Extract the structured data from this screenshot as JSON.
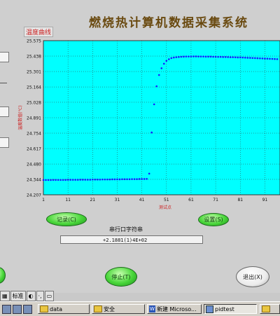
{
  "window": {
    "title": "燃烧热计算机数据采集系统"
  },
  "chart_panel": {
    "label": "温度曲线"
  },
  "chart_data": {
    "type": "scatter",
    "ylabel": "温度数值(℃)",
    "xlabel": "测试点",
    "x_ticks": [
      1,
      11,
      21,
      31,
      41,
      51,
      61,
      71,
      81,
      91
    ],
    "y_ticks": [
      24.207,
      24.344,
      24.48,
      24.617,
      24.754,
      24.891,
      25.028,
      25.164,
      25.301,
      25.438,
      25.575
    ],
    "xlim": [
      1,
      96
    ],
    "ylim": [
      24.207,
      25.575
    ],
    "background_color": "#00ffff",
    "marker_color": "#1a1aff",
    "points": [
      [
        1,
        24.338
      ],
      [
        2,
        24.338
      ],
      [
        3,
        24.338
      ],
      [
        4,
        24.338
      ],
      [
        5,
        24.339
      ],
      [
        6,
        24.339
      ],
      [
        7,
        24.339
      ],
      [
        8,
        24.339
      ],
      [
        9,
        24.339
      ],
      [
        10,
        24.339
      ],
      [
        11,
        24.34
      ],
      [
        12,
        24.34
      ],
      [
        13,
        24.34
      ],
      [
        14,
        24.34
      ],
      [
        15,
        24.34
      ],
      [
        16,
        24.341
      ],
      [
        17,
        24.341
      ],
      [
        18,
        24.341
      ],
      [
        19,
        24.341
      ],
      [
        20,
        24.341
      ],
      [
        21,
        24.342
      ],
      [
        22,
        24.342
      ],
      [
        23,
        24.342
      ],
      [
        24,
        24.342
      ],
      [
        25,
        24.343
      ],
      [
        26,
        24.343
      ],
      [
        27,
        24.343
      ],
      [
        28,
        24.343
      ],
      [
        29,
        24.344
      ],
      [
        30,
        24.344
      ],
      [
        31,
        24.344
      ],
      [
        32,
        24.344
      ],
      [
        33,
        24.345
      ],
      [
        34,
        24.345
      ],
      [
        35,
        24.345
      ],
      [
        36,
        24.345
      ],
      [
        37,
        24.346
      ],
      [
        38,
        24.346
      ],
      [
        39,
        24.346
      ],
      [
        40,
        24.347
      ],
      [
        41,
        24.347
      ],
      [
        42,
        24.347
      ],
      [
        43,
        24.348
      ],
      [
        44,
        24.395
      ],
      [
        45,
        24.76
      ],
      [
        46,
        25.01
      ],
      [
        47,
        25.17
      ],
      [
        48,
        25.27
      ],
      [
        49,
        25.33
      ],
      [
        50,
        25.37
      ],
      [
        51,
        25.396
      ],
      [
        52,
        25.41
      ],
      [
        53,
        25.42
      ],
      [
        54,
        25.425
      ],
      [
        55,
        25.428
      ],
      [
        56,
        25.43
      ],
      [
        57,
        25.432
      ],
      [
        58,
        25.433
      ],
      [
        59,
        25.434
      ],
      [
        60,
        25.434
      ],
      [
        61,
        25.435
      ],
      [
        62,
        25.435
      ],
      [
        63,
        25.435
      ],
      [
        64,
        25.434
      ],
      [
        65,
        25.434
      ],
      [
        66,
        25.434
      ],
      [
        67,
        25.433
      ],
      [
        68,
        25.433
      ],
      [
        69,
        25.433
      ],
      [
        70,
        25.432
      ],
      [
        71,
        25.432
      ],
      [
        72,
        25.431
      ],
      [
        73,
        25.431
      ],
      [
        74,
        25.43
      ],
      [
        75,
        25.43
      ],
      [
        76,
        25.429
      ],
      [
        77,
        25.428
      ],
      [
        78,
        25.428
      ],
      [
        79,
        25.427
      ],
      [
        80,
        25.426
      ],
      [
        81,
        25.426
      ],
      [
        82,
        25.425
      ],
      [
        83,
        25.424
      ],
      [
        84,
        25.423
      ],
      [
        85,
        25.422
      ],
      [
        86,
        25.421
      ],
      [
        87,
        25.42
      ],
      [
        88,
        25.419
      ],
      [
        89,
        25.418
      ],
      [
        90,
        25.417
      ],
      [
        91,
        25.416
      ],
      [
        92,
        25.415
      ],
      [
        93,
        25.414
      ],
      [
        94,
        25.413
      ],
      [
        95,
        25.412
      ],
      [
        96,
        25.411
      ]
    ]
  },
  "buttons": {
    "record": "记录(C)",
    "settings": "设置(S)",
    "stop": "停止(T)",
    "exit": "退出(X)"
  },
  "serial": {
    "label": "串行口字符串",
    "value": "+2.1881(1)4E+02"
  },
  "status_strip": {
    "items": [
      "标准"
    ]
  },
  "taskbar": {
    "items": [
      {
        "label": "data",
        "icon": "folder-icon"
      },
      {
        "label": "安全",
        "icon": "folder-icon"
      },
      {
        "label": "新建 Microso...",
        "icon": "word-icon"
      },
      {
        "label": "pidtest",
        "icon": "app-icon"
      }
    ]
  }
}
